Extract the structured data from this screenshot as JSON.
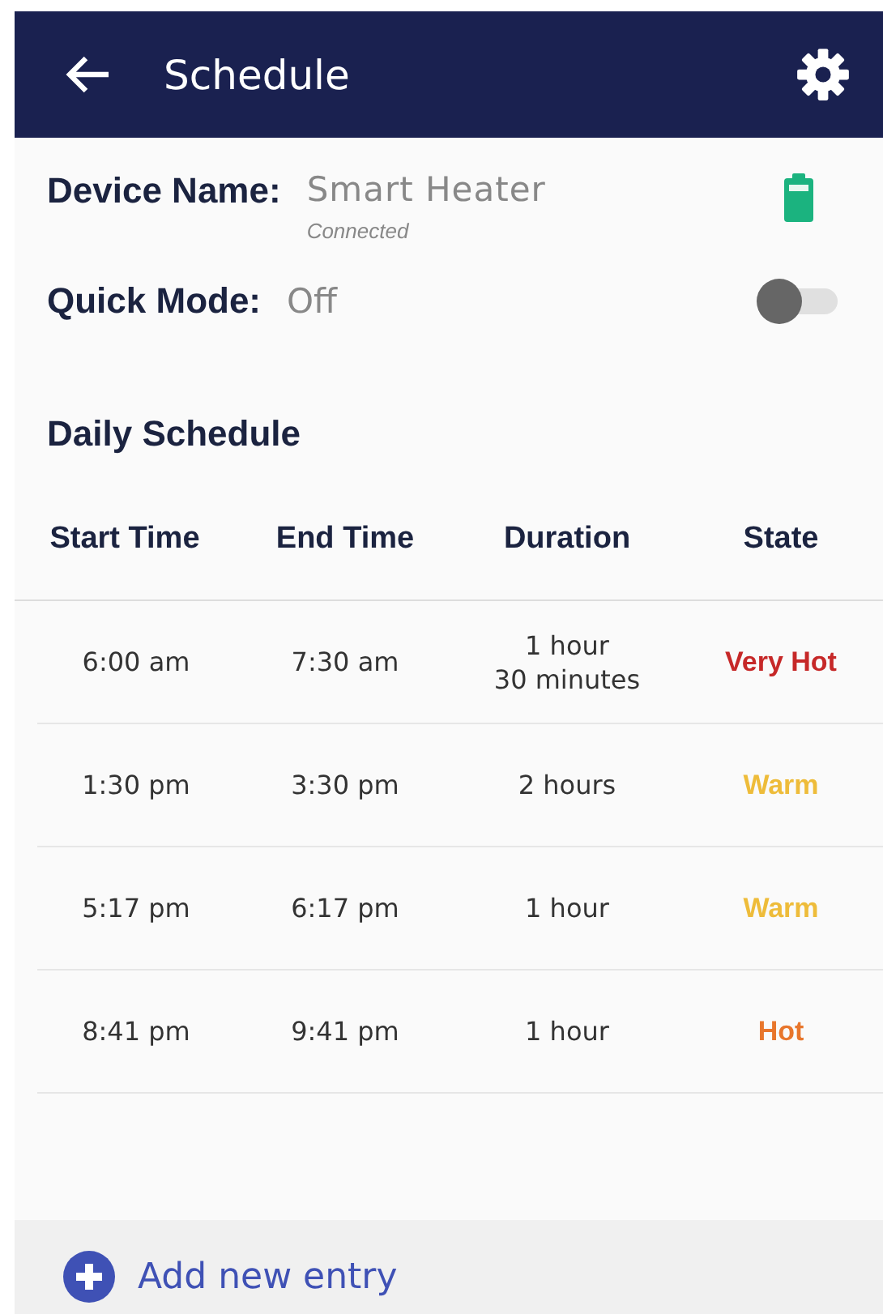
{
  "header": {
    "title": "Schedule"
  },
  "device": {
    "label": "Device Name:",
    "name": "Smart Heater",
    "status": "Connected"
  },
  "quick_mode": {
    "label": "Quick Mode:",
    "value": "Off",
    "on": false
  },
  "section_title": "Daily Schedule",
  "table": {
    "columns": [
      "Start Time",
      "End Time",
      "Duration",
      "State"
    ],
    "rows": [
      {
        "start": "6:00 am",
        "end": "7:30 am",
        "duration": [
          "1 hour",
          "30 minutes"
        ],
        "state": "Very Hot",
        "color": "#c62828"
      },
      {
        "start": "1:30 pm",
        "end": "3:30 pm",
        "duration": [
          "2 hours"
        ],
        "state": "Warm",
        "color": "#eebc3a"
      },
      {
        "start": "5:17 pm",
        "end": "6:17 pm",
        "duration": [
          "1 hour"
        ],
        "state": "Warm",
        "color": "#eebc3a"
      },
      {
        "start": "8:41 pm",
        "end": "9:41 pm",
        "duration": [
          "1 hour"
        ],
        "state": "Hot",
        "color": "#e8762c"
      }
    ]
  },
  "add_button": "Add new entry"
}
